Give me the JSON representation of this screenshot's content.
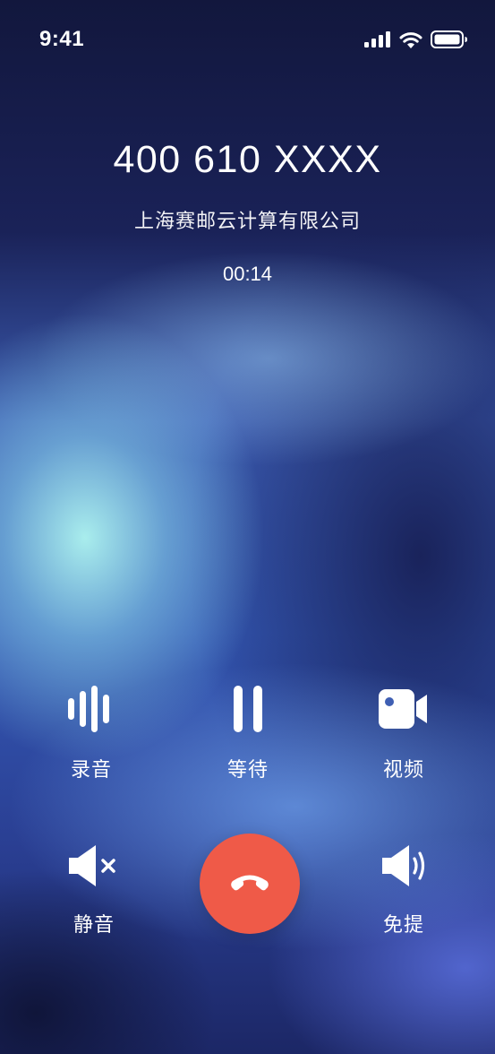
{
  "status_bar": {
    "time": "9:41",
    "icons": [
      "signal-icon",
      "wifi-icon",
      "battery-icon"
    ]
  },
  "call": {
    "number": "400 610 XXXX",
    "company": "上海赛邮云计算有限公司",
    "duration": "00:14"
  },
  "controls": {
    "record": {
      "label": "录音",
      "icon": "waveform-icon"
    },
    "hold": {
      "label": "等待",
      "icon": "pause-icon"
    },
    "video": {
      "label": "视频",
      "icon": "video-camera-icon"
    },
    "mute": {
      "label": "静音",
      "icon": "speaker-mute-icon"
    },
    "hangup": {
      "icon": "phone-hangup-icon",
      "color": "#ef5a48"
    },
    "speaker": {
      "label": "免提",
      "icon": "speaker-on-icon"
    }
  }
}
